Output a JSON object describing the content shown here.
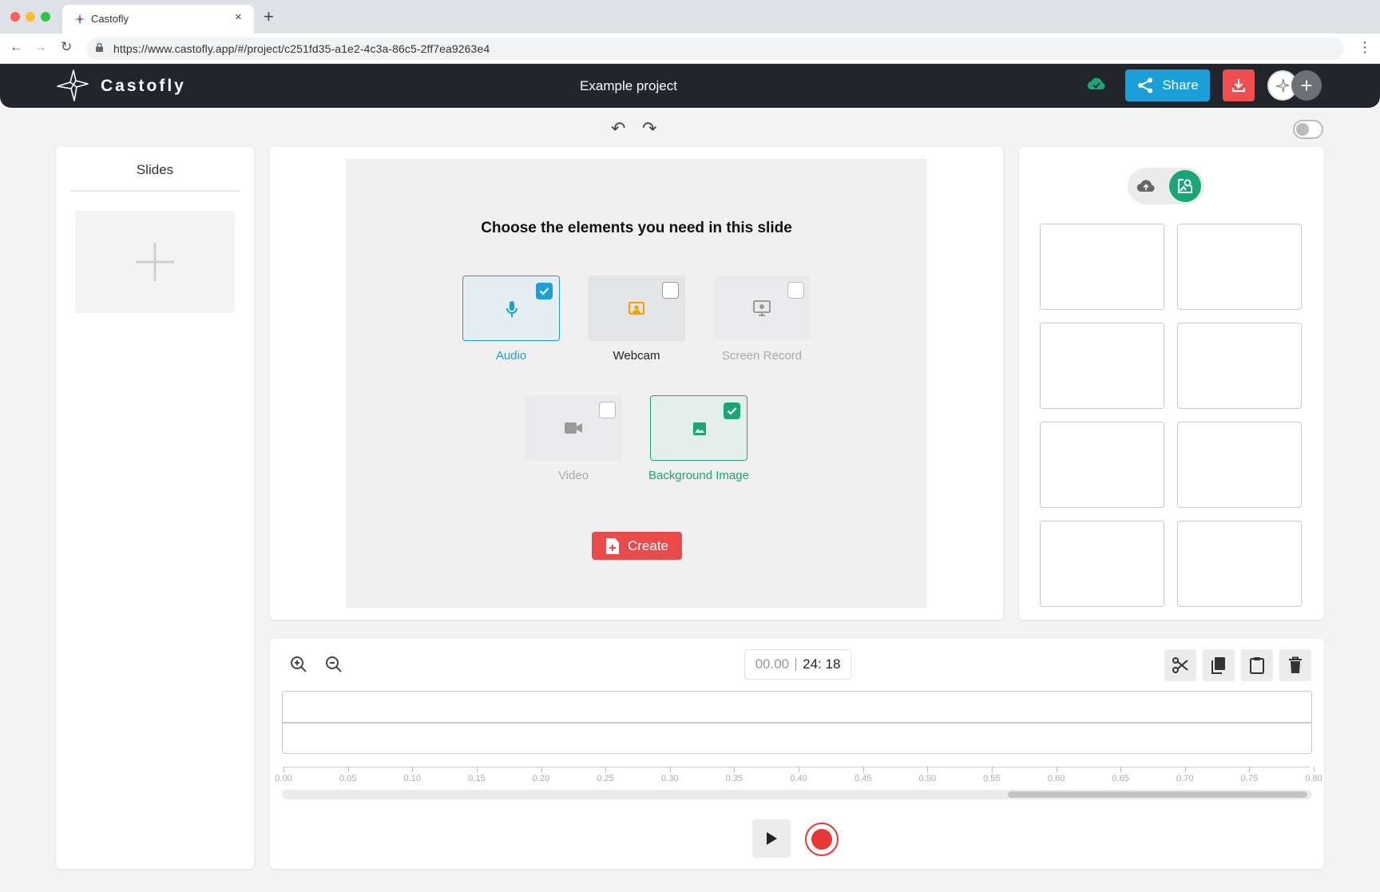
{
  "browser": {
    "tab_title": "Castofly",
    "tab_close": "×",
    "new_tab": "+",
    "url": "https://www.castofly.app/#/project/c251fd35-a1e2-4c3a-86c5-2ff7ea9263e4",
    "nav": {
      "back": "←",
      "forward": "→",
      "reload": "↻",
      "menu": "⋮"
    }
  },
  "header": {
    "brand": "Castofly",
    "project_title": "Example project",
    "share_label": "Share",
    "avatar_add": "+"
  },
  "toolbar": {
    "undo": "↶",
    "redo": "↷"
  },
  "slides": {
    "title": "Slides"
  },
  "editor": {
    "heading": "Choose the elements you need in this slide",
    "options": [
      {
        "label": "Audio",
        "checked": true,
        "icon": "microphone-icon",
        "color": "#1a9fd9"
      },
      {
        "label": "Webcam",
        "checked": false,
        "icon": "webcam-icon",
        "color": "#f5a000"
      },
      {
        "label": "Screen Record",
        "checked": false,
        "icon": "monitor-icon",
        "color": "#9a9a9a"
      },
      {
        "label": "Video",
        "checked": false,
        "icon": "video-camera-icon",
        "color": "#9a9a9a"
      },
      {
        "label": "Background Image",
        "checked": true,
        "icon": "image-icon",
        "color": "#1aa576"
      }
    ],
    "create_label": "Create"
  },
  "timeline": {
    "current_time": "00.00",
    "total_time": "24: 18",
    "ruler_labels": [
      "0.00",
      "0.05",
      "0.10",
      "0.15",
      "0.20",
      "0.25",
      "0.30",
      "0.35",
      "0.40",
      "0.45",
      "0.50",
      "0.55",
      "0.60",
      "0.65",
      "0.70",
      "0.75",
      "0.80"
    ],
    "scroll_position": 0.705,
    "scroll_visible_fraction": 0.29
  },
  "colors": {
    "accent_blue": "#1a9fd9",
    "accent_green": "#1aa576",
    "accent_red": "#e94b4b",
    "header_bg": "#22252b"
  }
}
